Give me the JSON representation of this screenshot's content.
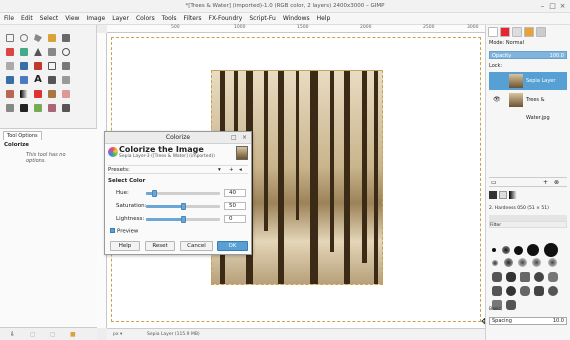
{
  "window": {
    "title": "*[Trees & Water] (imported)-1.0 (RGB color, 2 layers) 2400x3000 – GIMP"
  },
  "menu": [
    "File",
    "Edit",
    "Select",
    "View",
    "Image",
    "Layer",
    "Colors",
    "Tools",
    "Filters",
    "FX-Foundry",
    "Script-Fu",
    "Windows",
    "Help"
  ],
  "ruler": {
    "labels": [
      "500",
      "1000",
      "1500",
      "2000",
      "2500",
      "3000"
    ]
  },
  "tool_options": {
    "tab": "Tool Options",
    "title": "Colorize",
    "note": "This tool has no options."
  },
  "statusbar": {
    "text": "Sepia Layer (115.9 MB)"
  },
  "right_panel": {
    "mode_label": "Mode: Normal",
    "opacity_label": "Opacity",
    "opacity_value": "100.0",
    "lock_label": "Lock:",
    "layers": [
      {
        "name": "Sepia Layer",
        "selected": true
      },
      {
        "name": "Trees & Water.jpg",
        "selected": false
      }
    ],
    "brush_filter": "Filter",
    "brush_name": "2. Hardness 050 (51 × 51)",
    "brush_set": "Basic,",
    "spacing_label": "Spacing",
    "spacing_value": "10.0"
  },
  "colorize": {
    "title": "Colorize",
    "heading": "Colorize the Image",
    "subtitle": "Sepia Layer-3 ([Trees & Water] (imported))",
    "presets_label": "Presets:",
    "section": "Select Color",
    "sliders": [
      {
        "label": "Hue:",
        "value": "40",
        "fraction": 0.11
      },
      {
        "label": "Saturation:",
        "value": "50",
        "fraction": 0.5
      },
      {
        "label": "Lightness:",
        "value": "0",
        "fraction": 0.5
      }
    ],
    "preview_label": "Preview",
    "buttons": {
      "help": "Help",
      "reset": "Reset",
      "cancel": "Cancel",
      "ok": "OK"
    }
  },
  "colors": {
    "accent": "#56a0d3",
    "sepia": "#c9b48c"
  }
}
